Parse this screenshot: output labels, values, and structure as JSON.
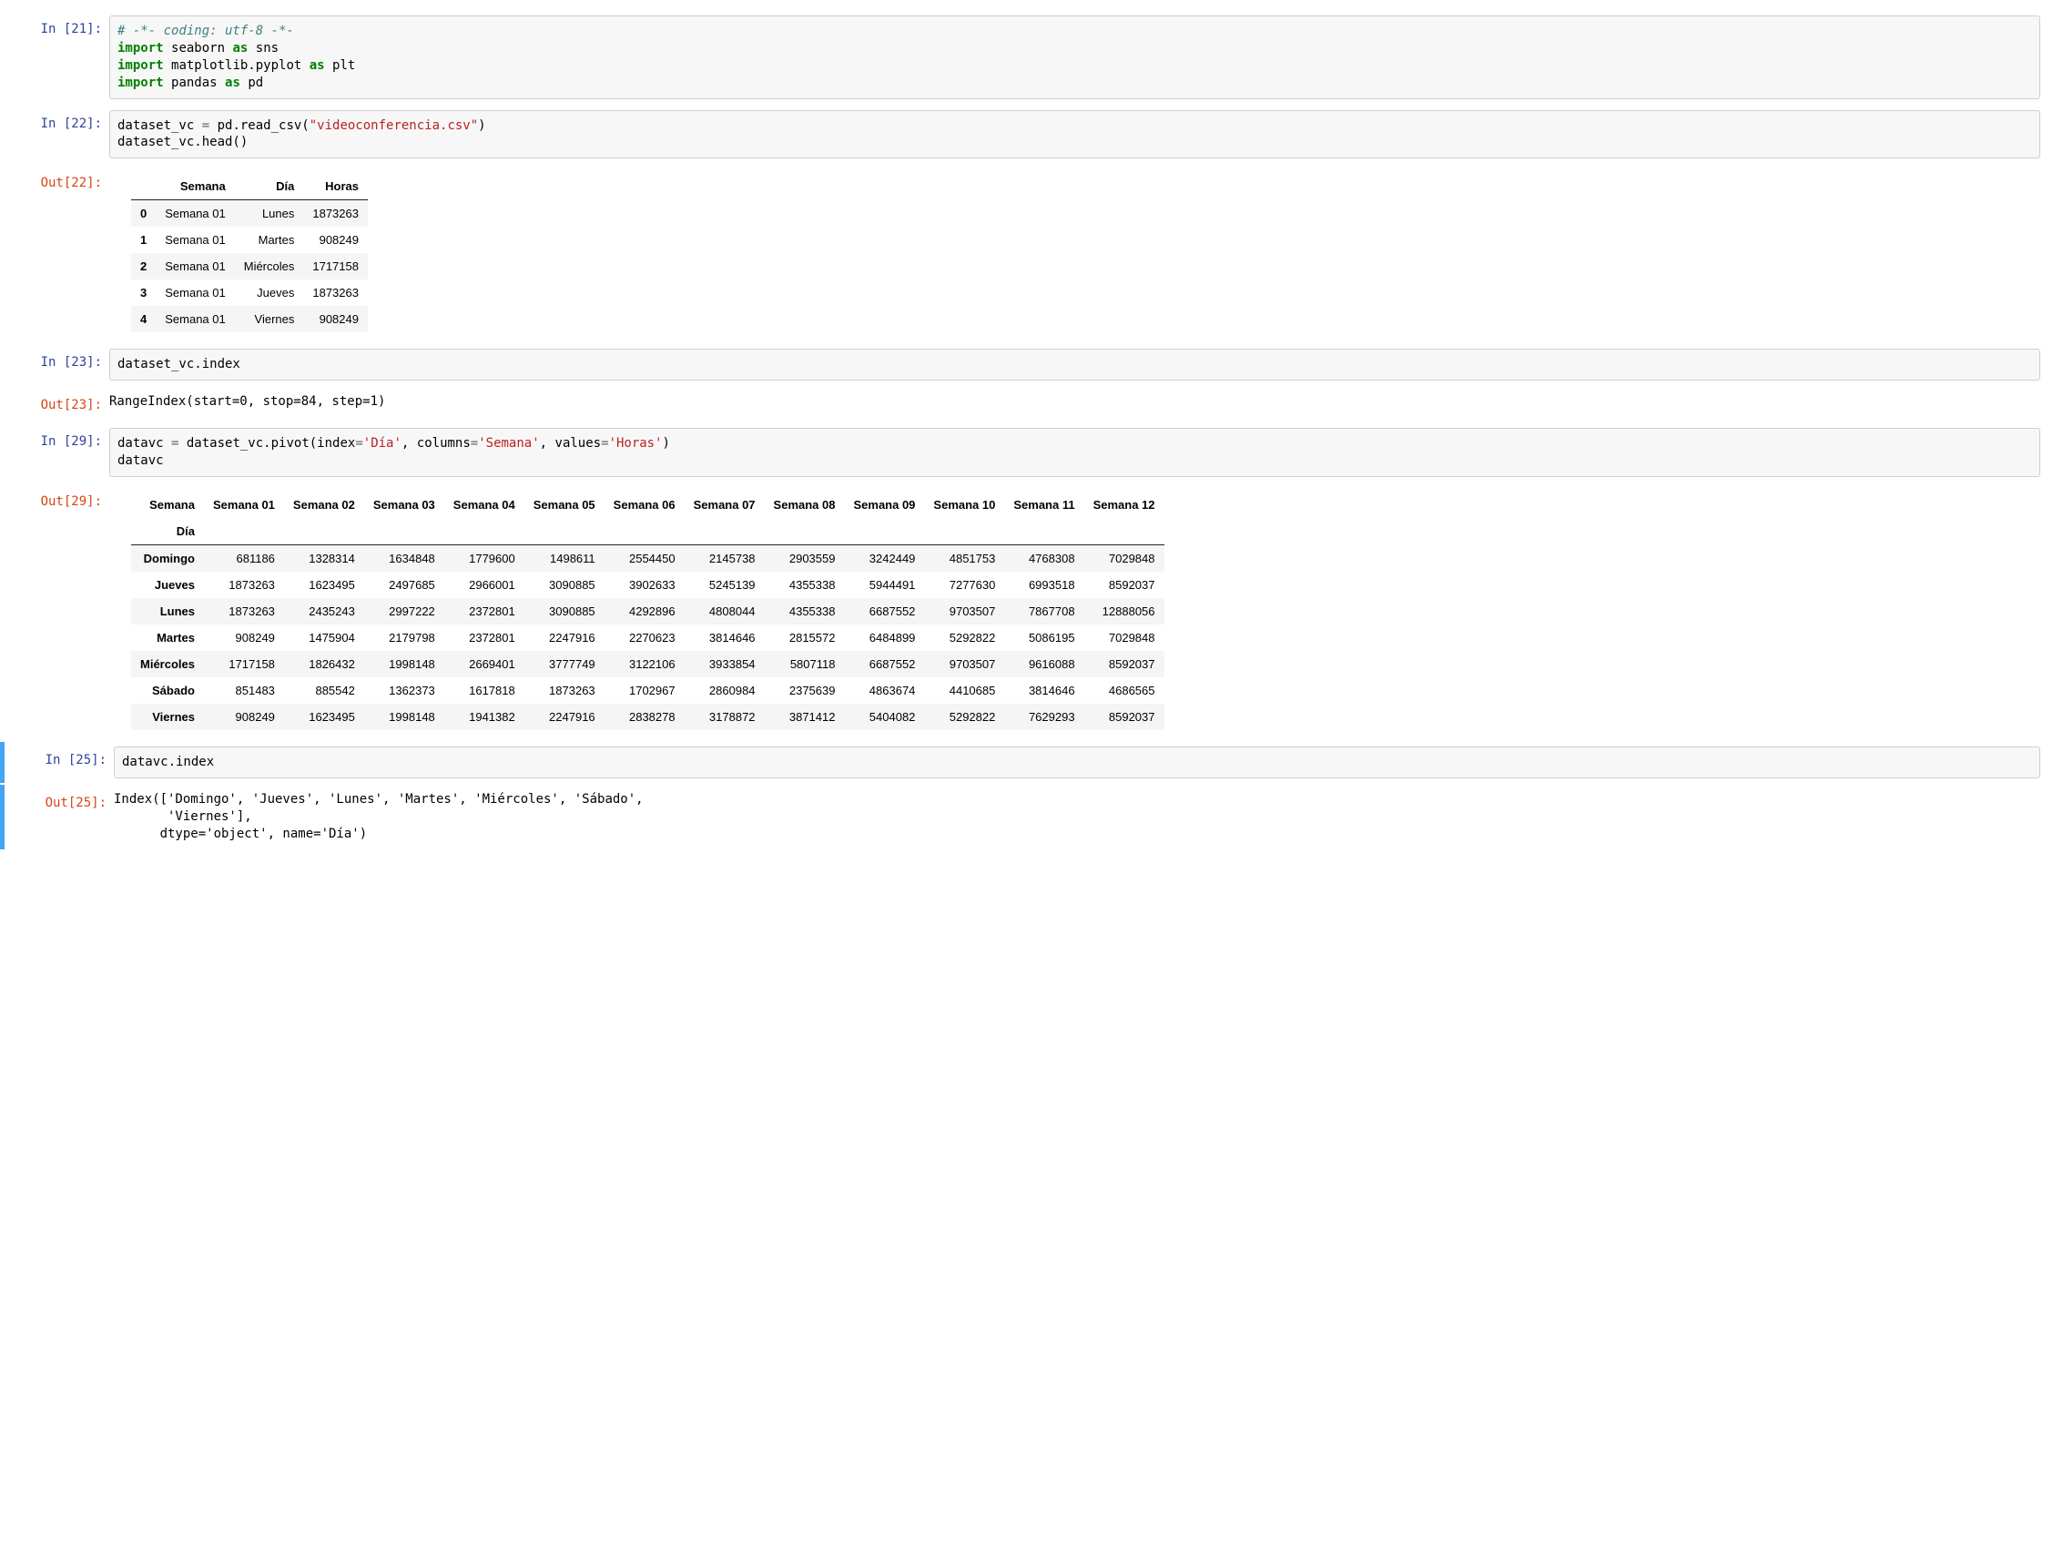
{
  "cells": {
    "21": {
      "in_prompt": "In [21]:",
      "code": {
        "comment": "# -*- coding: utf-8 -*-",
        "kw_import1": "import",
        "mod1": "seaborn",
        "kw_as1": "as",
        "alias1": "sns",
        "kw_import2": "import",
        "mod2": "matplotlib.pyplot",
        "kw_as2": "as",
        "alias2": "plt",
        "kw_import3": "import",
        "mod3": "pandas",
        "kw_as3": "as",
        "alias3": "pd"
      }
    },
    "22": {
      "in_prompt": "In [22]:",
      "out_prompt": "Out[22]:",
      "code": {
        "line1_a": "dataset_vc ",
        "line1_op": "=",
        "line1_b": " pd.read_csv(",
        "line1_str": "\"videoconferencia.csv\"",
        "line1_c": ")",
        "line2": "dataset_vc.head()"
      },
      "table": {
        "headers": [
          "",
          "Semana",
          "Día",
          "Horas"
        ],
        "rows": [
          [
            "0",
            "Semana 01",
            "Lunes",
            "1873263"
          ],
          [
            "1",
            "Semana 01",
            "Martes",
            "908249"
          ],
          [
            "2",
            "Semana 01",
            "Miércoles",
            "1717158"
          ],
          [
            "3",
            "Semana 01",
            "Jueves",
            "1873263"
          ],
          [
            "4",
            "Semana 01",
            "Viernes",
            "908249"
          ]
        ]
      }
    },
    "23": {
      "in_prompt": "In [23]:",
      "out_prompt": "Out[23]:",
      "code": "dataset_vc.index",
      "output": "RangeIndex(start=0, stop=84, step=1)"
    },
    "29": {
      "in_prompt": "In [29]:",
      "out_prompt": "Out[29]:",
      "code": {
        "line1_a": "datavc ",
        "line1_op": "=",
        "line1_b": " dataset_vc.pivot(index",
        "line1_op2": "=",
        "line1_s1": "'Día'",
        "line1_c": ", columns",
        "line1_op3": "=",
        "line1_s2": "'Semana'",
        "line1_d": ", values",
        "line1_op4": "=",
        "line1_s3": "'Horas'",
        "line1_e": ")",
        "line2": "datavc"
      },
      "table": {
        "col_name": "Semana",
        "idx_name": "Día",
        "columns": [
          "Semana 01",
          "Semana 02",
          "Semana 03",
          "Semana 04",
          "Semana 05",
          "Semana 06",
          "Semana 07",
          "Semana 08",
          "Semana 09",
          "Semana 10",
          "Semana 11",
          "Semana 12"
        ],
        "rows": [
          {
            "idx": "Domingo",
            "vals": [
              "681186",
              "1328314",
              "1634848",
              "1779600",
              "1498611",
              "2554450",
              "2145738",
              "2903559",
              "3242449",
              "4851753",
              "4768308",
              "7029848"
            ]
          },
          {
            "idx": "Jueves",
            "vals": [
              "1873263",
              "1623495",
              "2497685",
              "2966001",
              "3090885",
              "3902633",
              "5245139",
              "4355338",
              "5944491",
              "7277630",
              "6993518",
              "8592037"
            ]
          },
          {
            "idx": "Lunes",
            "vals": [
              "1873263",
              "2435243",
              "2997222",
              "2372801",
              "3090885",
              "4292896",
              "4808044",
              "4355338",
              "6687552",
              "9703507",
              "7867708",
              "12888056"
            ]
          },
          {
            "idx": "Martes",
            "vals": [
              "908249",
              "1475904",
              "2179798",
              "2372801",
              "2247916",
              "2270623",
              "3814646",
              "2815572",
              "6484899",
              "5292822",
              "5086195",
              "7029848"
            ]
          },
          {
            "idx": "Miércoles",
            "vals": [
              "1717158",
              "1826432",
              "1998148",
              "2669401",
              "3777749",
              "3122106",
              "3933854",
              "5807118",
              "6687552",
              "9703507",
              "9616088",
              "8592037"
            ]
          },
          {
            "idx": "Sábado",
            "vals": [
              "851483",
              "885542",
              "1362373",
              "1617818",
              "1873263",
              "1702967",
              "2860984",
              "2375639",
              "4863674",
              "4410685",
              "3814646",
              "4686565"
            ]
          },
          {
            "idx": "Viernes",
            "vals": [
              "908249",
              "1623495",
              "1998148",
              "1941382",
              "2247916",
              "2838278",
              "3178872",
              "3871412",
              "5404082",
              "5292822",
              "7629293",
              "8592037"
            ]
          }
        ]
      }
    },
    "25": {
      "in_prompt": "In [25]:",
      "out_prompt": "Out[25]:",
      "code": "datavc.index",
      "output": "Index(['Domingo', 'Jueves', 'Lunes', 'Martes', 'Miércoles', 'Sábado',\n       'Viernes'],\n      dtype='object', name='Día')"
    }
  }
}
